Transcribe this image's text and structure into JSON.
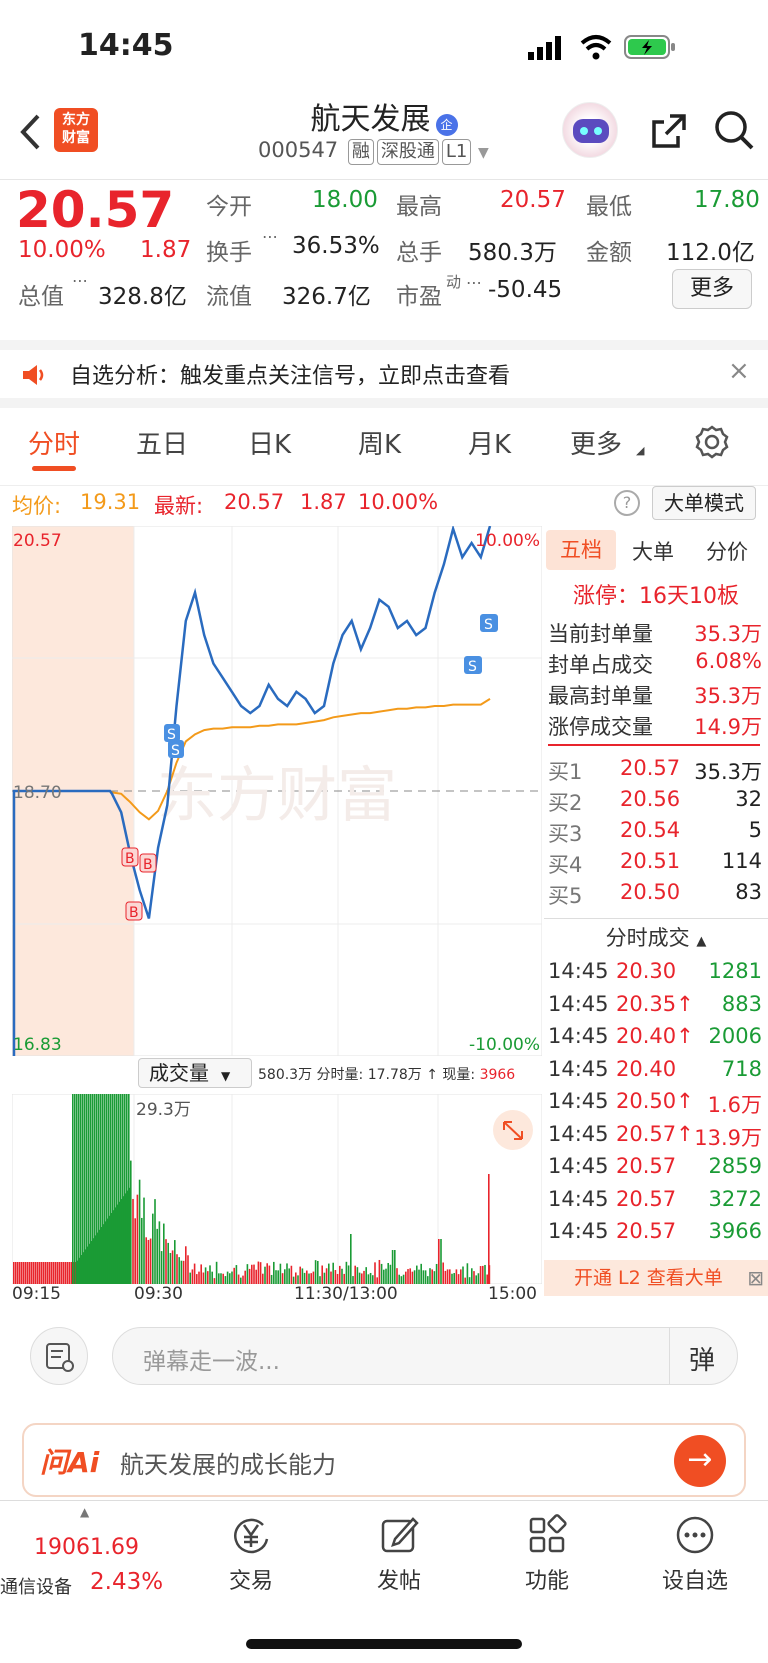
{
  "status": {
    "time": "14:45"
  },
  "header": {
    "title": "航天发展",
    "title_badge": "企",
    "code": "000547",
    "tags": [
      "融",
      "深股通",
      "L1"
    ],
    "logo_text": "东方\n财富"
  },
  "quote": {
    "price": "20.57",
    "pct": "10.00%",
    "change": "1.87",
    "open_label": "今开",
    "open": "18.00",
    "high_label": "最高",
    "high": "20.57",
    "low_label": "最低",
    "low": "17.80",
    "turnover_label": "换手",
    "turnover": "36.53%",
    "volume_label": "总手",
    "volume": "580.3万",
    "amount_label": "金额",
    "amount": "112.0亿",
    "mktcap_label": "总值",
    "mktcap": "328.8亿",
    "float_label": "流值",
    "float": "326.7亿",
    "pe_label": "市盈",
    "pe_sup": "动",
    "pe": "-50.45",
    "more": "更多"
  },
  "notice": {
    "text": "自选分析：触发重点关注信号，立即点击查看"
  },
  "tabs": [
    "分时",
    "五日",
    "日K",
    "周K",
    "月K",
    "更多"
  ],
  "avg_bar": {
    "avg_label": "均价:",
    "avg": "19.31",
    "latest_label": "最新:",
    "latest": "20.57",
    "chg": "1.87",
    "pct": "10.00%",
    "mode_btn": "大单模式"
  },
  "chart": {
    "top_price": "20.57",
    "mid_price": "18.70",
    "bottom_price": "16.83",
    "top_pct": "10.00%",
    "bottom_pct": "-10.00%",
    "watermark": "东方财富"
  },
  "volume_bar": {
    "selector": "成交量",
    "info": "580.3万 分时量: 17.78万 ↑ 现量: ",
    "now": "3966",
    "peak_label": "29.3万"
  },
  "time_axis": [
    "09:15",
    "09:30",
    "11:30/13:00",
    "15:00"
  ],
  "chart_data": {
    "type": "line",
    "x_labels": [
      "09:15",
      "09:30",
      "11:30/13:00",
      "15:00"
    ],
    "ylim": [
      16.83,
      20.57
    ],
    "prev_close": 18.7,
    "series": [
      {
        "values": [
          18.7,
          18.7,
          18.7,
          18.68,
          18.55,
          18.25,
          18.0,
          17.8,
          18.3,
          18.6,
          19.3,
          19.9,
          20.1,
          19.8,
          19.6,
          19.5,
          19.4,
          19.3,
          19.25,
          19.3,
          19.45,
          19.35,
          19.3,
          19.4,
          19.35,
          19.25,
          19.3,
          19.6,
          19.8,
          19.9,
          19.7,
          19.85,
          20.05,
          20.0,
          19.85,
          19.9,
          19.8,
          19.85,
          20.1,
          20.3,
          20.55,
          20.35,
          20.45,
          20.35,
          20.57
        ]
      },
      {
        "values": [
          18.7,
          18.7,
          18.7,
          18.69,
          18.68,
          18.62,
          18.55,
          18.5,
          18.56,
          18.7,
          18.9,
          19.05,
          19.1,
          19.13,
          19.14,
          19.14,
          19.15,
          19.15,
          19.15,
          19.16,
          19.16,
          19.17,
          19.17,
          19.17,
          19.18,
          19.19,
          19.2,
          19.22,
          19.23,
          19.24,
          19.25,
          19.25,
          19.26,
          19.27,
          19.28,
          19.28,
          19.29,
          19.29,
          19.3,
          19.3,
          19.31,
          19.31,
          19.31,
          19.31,
          19.35
        ]
      }
    ]
  },
  "right": {
    "tabs": [
      "五档",
      "大单",
      "分价"
    ],
    "limit_text": "涨停：16天10板",
    "seal": [
      {
        "label": "当前封单量",
        "value": "35.3万"
      },
      {
        "label": "封单占成交",
        "value": "6.08%"
      },
      {
        "label": "最高封单量",
        "value": "35.3万"
      },
      {
        "label": "涨停成交量",
        "value": "14.9万"
      }
    ],
    "bids": [
      {
        "label": "买1",
        "price": "20.57",
        "vol": "35.3万"
      },
      {
        "label": "买2",
        "price": "20.56",
        "vol": "32"
      },
      {
        "label": "买3",
        "price": "20.54",
        "vol": "5"
      },
      {
        "label": "买4",
        "price": "20.51",
        "vol": "114"
      },
      {
        "label": "买5",
        "price": "20.50",
        "vol": "83"
      }
    ],
    "trades_title": "分时成交",
    "trades": [
      {
        "t": "14:45",
        "p": "20.30",
        "v": "1281"
      },
      {
        "t": "14:45",
        "p": "20.35↑",
        "v": "883"
      },
      {
        "t": "14:45",
        "p": "20.40↑",
        "v": "2006"
      },
      {
        "t": "14:45",
        "p": "20.40",
        "v": "718"
      },
      {
        "t": "14:45",
        "p": "20.50↑",
        "v": "1.6万"
      },
      {
        "t": "14:45",
        "p": "20.57↑",
        "v": "13.9万"
      },
      {
        "t": "14:45",
        "p": "20.57",
        "v": "2859"
      },
      {
        "t": "14:45",
        "p": "20.57",
        "v": "3272"
      },
      {
        "t": "14:45",
        "p": "20.57",
        "v": "3966"
      }
    ],
    "l2": "开通 L2 查看大单"
  },
  "danmu": {
    "placeholder": "弹幕走一波...",
    "btn": "弹"
  },
  "ai": {
    "logo": "问Ai",
    "text": "航天发展的成长能力"
  },
  "bottom": {
    "index_value": "19061.69",
    "index_name": "通信设备",
    "index_pct": "2.43%",
    "items": [
      "交易",
      "发帖",
      "功能",
      "设自选"
    ]
  }
}
